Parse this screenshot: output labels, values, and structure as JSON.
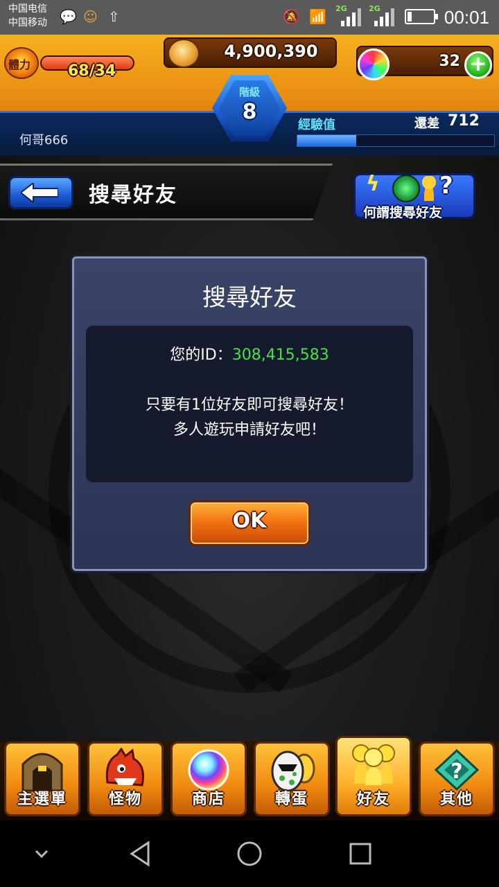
{
  "status_bar": {
    "carrier_1": "中国电信",
    "carrier_2": "中国移动",
    "signal_1_label": "2G",
    "signal_2_label": "2G",
    "time": "00:01"
  },
  "header": {
    "stamina_label": "體力",
    "stamina_value": "68/34",
    "coins": "4,900,390",
    "orbs": "32",
    "rank_label": "階級",
    "rank_value": "8",
    "player_name": "何哥666",
    "exp_label": "經驗值",
    "exp_remaining_label": "還差",
    "exp_remaining_value": "712",
    "exp_progress": 0.3
  },
  "page": {
    "title": "搜尋好友",
    "help_label": "何謂搜尋好友"
  },
  "dialog": {
    "title": "搜尋好友",
    "id_label": "您的ID：",
    "id_value": "308,415,583",
    "message_line_1": "只要有1位好友即可搜尋好友！",
    "message_line_2": "多人遊玩申請好友吧！",
    "ok_label": "OK"
  },
  "bottom_menu": [
    {
      "label": "主選單",
      "icon": "gate-icon"
    },
    {
      "label": "怪物",
      "icon": "monster-icon"
    },
    {
      "label": "商店",
      "icon": "rainbow-orb-icon"
    },
    {
      "label": "轉蛋",
      "icon": "egg-icon"
    },
    {
      "label": "好友",
      "icon": "friends-icon"
    },
    {
      "label": "其他",
      "icon": "other-icon"
    }
  ],
  "colors": {
    "header_orange": "#f7b120",
    "id_green": "#4ae04a",
    "dialog_bg": "#3a4468",
    "ok_orange": "#f07010"
  }
}
